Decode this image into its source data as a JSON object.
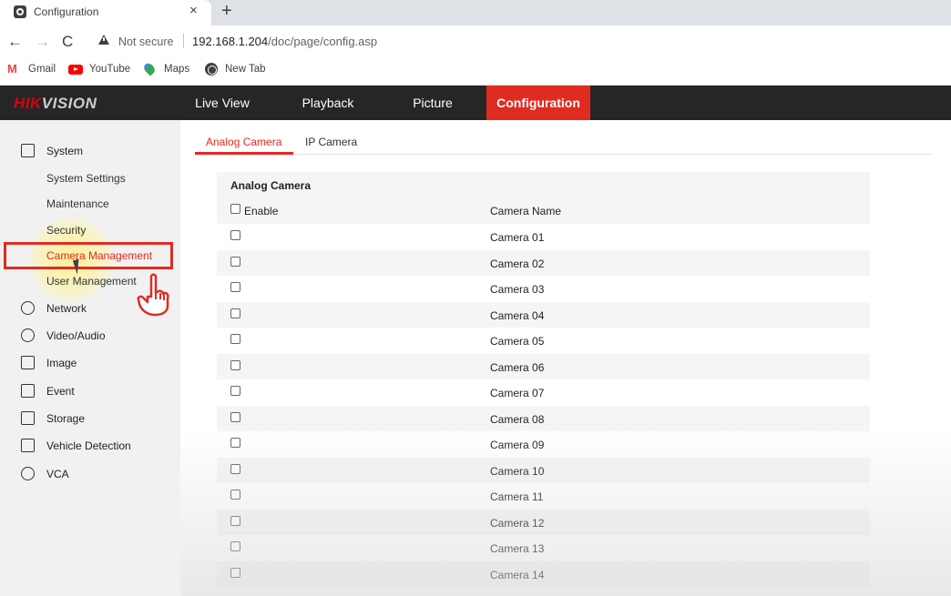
{
  "browser": {
    "tab_title": "Configuration",
    "tab_close": "×",
    "new_tab": "+",
    "back": "←",
    "forward": "→",
    "reload": "C",
    "security_label": "Not secure",
    "url_host": "192.168.1.204",
    "url_path": "/doc/page/config.asp",
    "bookmarks": [
      {
        "label": "Gmail",
        "icon": "gmail-icon"
      },
      {
        "label": "YouTube",
        "icon": "youtube-icon"
      },
      {
        "label": "Maps",
        "icon": "maps-icon"
      },
      {
        "label": "New Tab",
        "icon": "new-tab-icon"
      }
    ]
  },
  "app": {
    "logo_hik": "HIK",
    "logo_vision": "VISION",
    "nav": [
      {
        "label": "Live View"
      },
      {
        "label": "Playback"
      },
      {
        "label": "Picture"
      },
      {
        "label": "Configuration",
        "active": true
      }
    ],
    "accent_color": "#e02b21"
  },
  "sidebar": {
    "system": {
      "label": "System",
      "icon": "system-icon"
    },
    "system_sub": [
      {
        "label": "System Settings"
      },
      {
        "label": "Maintenance"
      },
      {
        "label": "Security"
      },
      {
        "label": "Camera Management",
        "active": true
      },
      {
        "label": "User Management"
      }
    ],
    "sections": [
      {
        "label": "Network",
        "icon": "network-icon"
      },
      {
        "label": "Video/Audio",
        "icon": "video-audio-icon"
      },
      {
        "label": "Image",
        "icon": "image-icon"
      },
      {
        "label": "Event",
        "icon": "event-icon"
      },
      {
        "label": "Storage",
        "icon": "storage-icon"
      },
      {
        "label": "Vehicle Detection",
        "icon": "vehicle-detection-icon"
      },
      {
        "label": "VCA",
        "icon": "vca-icon"
      }
    ]
  },
  "main": {
    "tabs": [
      {
        "label": "Analog Camera",
        "active": true
      },
      {
        "label": "IP Camera"
      }
    ],
    "table": {
      "title": "Analog Camera",
      "enable_label": "Enable",
      "name_header": "Camera Name",
      "rows": [
        {
          "name": "Camera 01",
          "enabled": false
        },
        {
          "name": "Camera 02",
          "enabled": false
        },
        {
          "name": "Camera 03",
          "enabled": false
        },
        {
          "name": "Camera 04",
          "enabled": false
        },
        {
          "name": "Camera 05",
          "enabled": false
        },
        {
          "name": "Camera 06",
          "enabled": false
        },
        {
          "name": "Camera 07",
          "enabled": false
        },
        {
          "name": "Camera 08",
          "enabled": false
        },
        {
          "name": "Camera 09",
          "enabled": false
        },
        {
          "name": "Camera 10",
          "enabled": false
        },
        {
          "name": "Camera 11",
          "enabled": false
        },
        {
          "name": "Camera 12",
          "enabled": false
        },
        {
          "name": "Camera 13",
          "enabled": false
        },
        {
          "name": "Camera 14",
          "enabled": false
        }
      ]
    }
  }
}
